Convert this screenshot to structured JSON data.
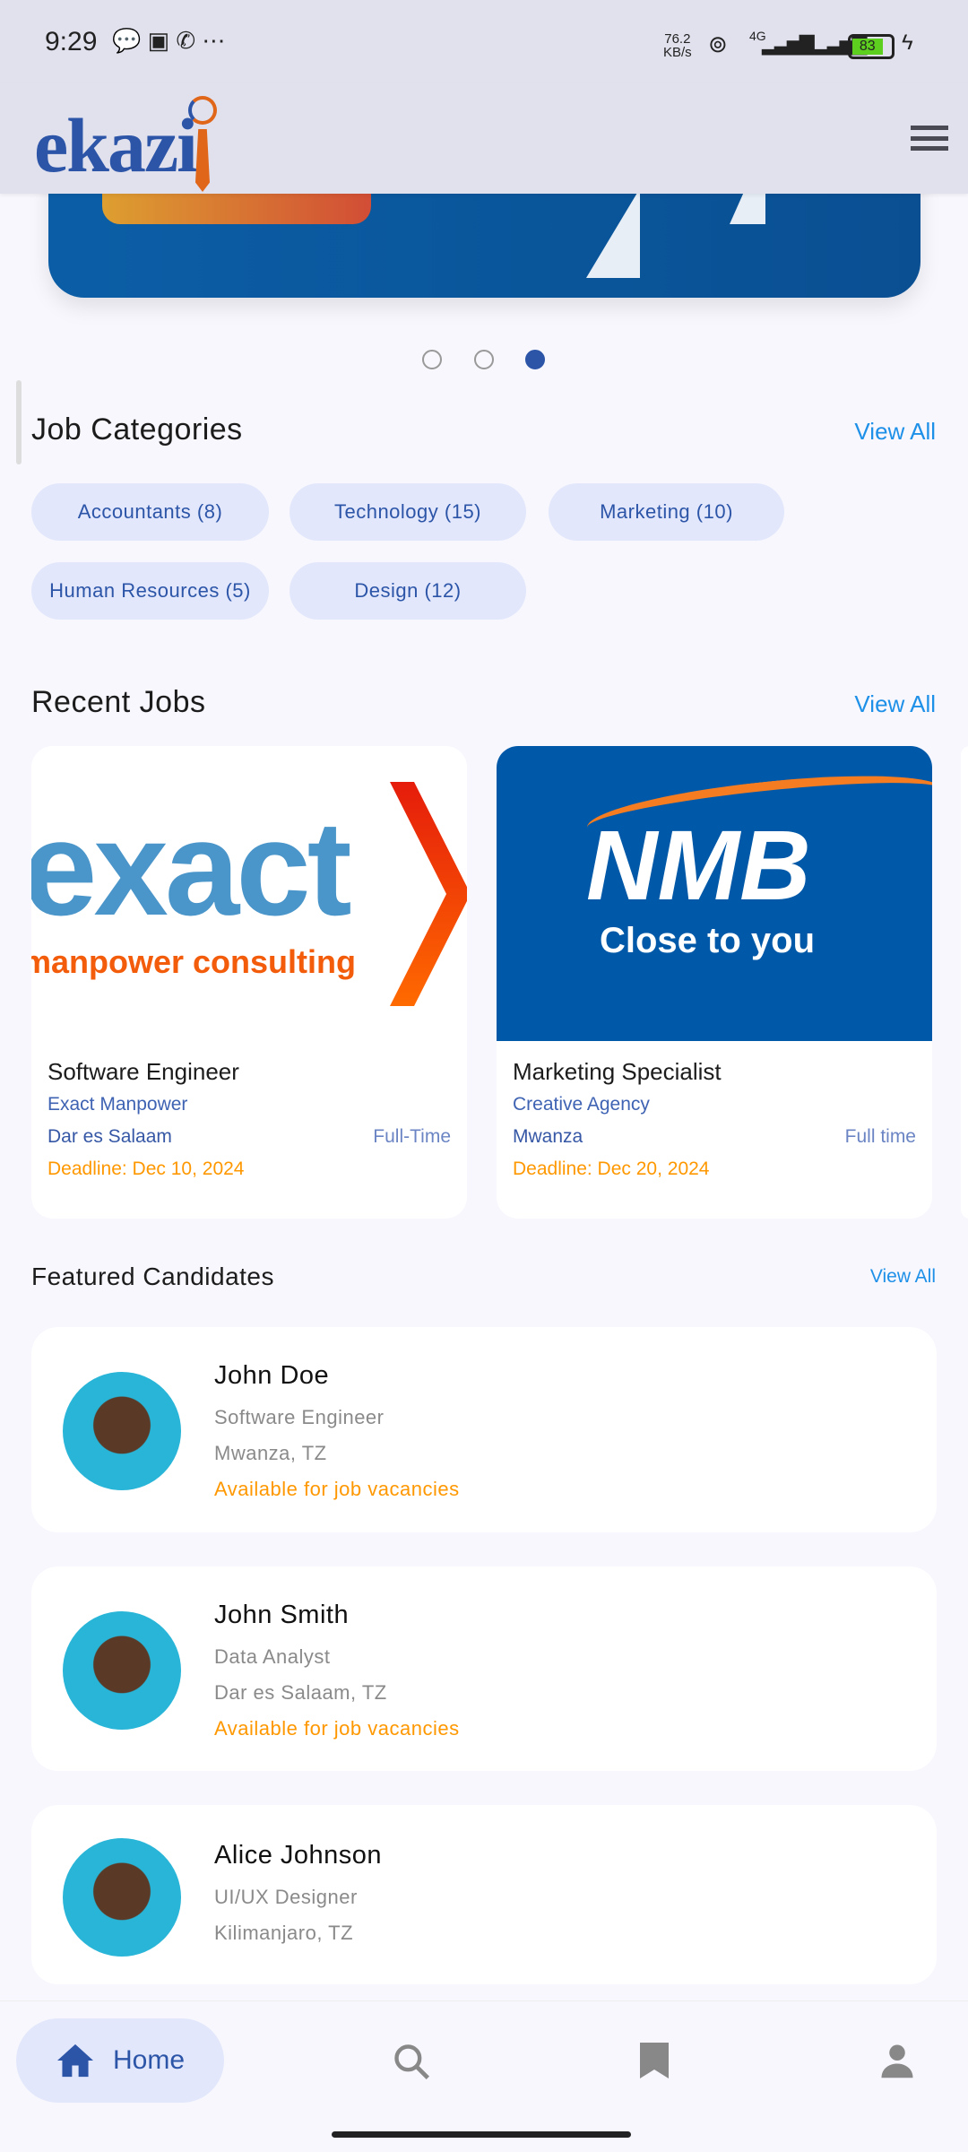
{
  "status_bar": {
    "time": "9:29",
    "net_speed": "76.2",
    "net_unit": "KB/s",
    "network": "4G",
    "battery": "83"
  },
  "header": {
    "logo": "ekazi"
  },
  "carousel": {
    "slides": 3,
    "active": 3
  },
  "categories": {
    "title": "Job Categories",
    "view_all": "View All",
    "items": [
      {
        "label": "Accountants (8)"
      },
      {
        "label": "Technology (15)"
      },
      {
        "label": "Marketing (10)"
      },
      {
        "label": "Human Resources (5)"
      },
      {
        "label": "Design (12)"
      }
    ]
  },
  "recent_jobs": {
    "title": "Recent Jobs",
    "view_all": "View All",
    "jobs": [
      {
        "logo_main": "exact",
        "logo_sub": "manpower consulting",
        "title": "Software Engineer",
        "company": "Exact Manpower",
        "location": "Dar es Salaam",
        "type": "Full-Time",
        "deadline": "Deadline: Dec 10, 2024"
      },
      {
        "logo_main": "NMB",
        "logo_sub": "Close to you",
        "title": "Marketing Specialist",
        "company": "Creative Agency",
        "location": "Mwanza",
        "type": "Full time",
        "deadline": "Deadline: Dec 20, 2024"
      }
    ]
  },
  "candidates": {
    "title": "Featured Candidates",
    "view_all": "View All",
    "items": [
      {
        "name": "John Doe",
        "role": "Software Engineer",
        "location": "Mwanza, TZ",
        "availability": "Available for job vacancies"
      },
      {
        "name": "John Smith",
        "role": "Data Analyst",
        "location": "Dar es Salaam, TZ",
        "availability": "Available for job vacancies"
      },
      {
        "name": "Alice Johnson",
        "role": "UI/UX Designer",
        "location": "Kilimanjaro, TZ"
      }
    ]
  },
  "nav": {
    "home": "Home"
  },
  "colors": {
    "brand": "#2c55a8",
    "accent": "#ff9800",
    "link": "#1e90e8"
  }
}
